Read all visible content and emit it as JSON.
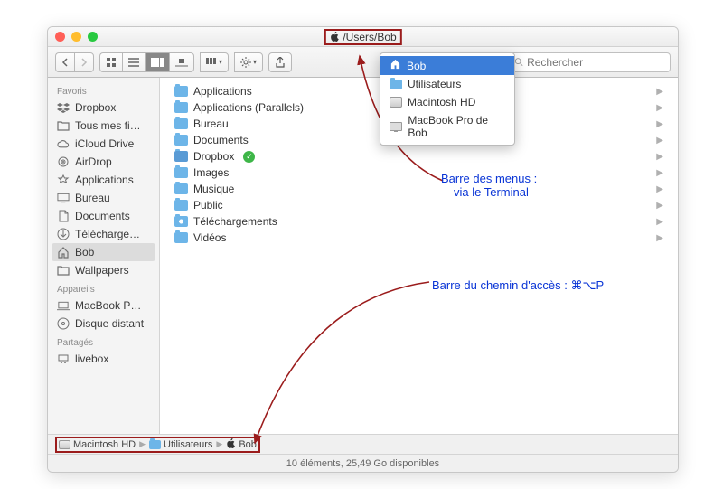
{
  "title_path": "/Users/Bob",
  "search_placeholder": "Rechercher",
  "sidebar": {
    "sections": [
      {
        "header": "Favoris",
        "items": [
          {
            "icon": "dropbox",
            "label": "Dropbox"
          },
          {
            "icon": "folder",
            "label": "Tous mes fi…"
          },
          {
            "icon": "cloud",
            "label": "iCloud Drive"
          },
          {
            "icon": "airdrop",
            "label": "AirDrop"
          },
          {
            "icon": "apps",
            "label": "Applications"
          },
          {
            "icon": "desktop",
            "label": "Bureau"
          },
          {
            "icon": "docs",
            "label": "Documents"
          },
          {
            "icon": "download",
            "label": "Télécharge…"
          },
          {
            "icon": "home",
            "label": "Bob",
            "selected": true
          },
          {
            "icon": "folder",
            "label": "Wallpapers"
          }
        ]
      },
      {
        "header": "Appareils",
        "items": [
          {
            "icon": "laptop",
            "label": "MacBook P…"
          },
          {
            "icon": "disc",
            "label": "Disque distant"
          }
        ]
      },
      {
        "header": "Partagés",
        "items": [
          {
            "icon": "net",
            "label": "livebox"
          }
        ]
      }
    ]
  },
  "files": [
    {
      "label": "Applications",
      "icon": "folder"
    },
    {
      "label": "Applications (Parallels)",
      "icon": "folder"
    },
    {
      "label": "Bureau",
      "icon": "folder"
    },
    {
      "label": "Documents",
      "icon": "folder"
    },
    {
      "label": "Dropbox",
      "icon": "folder-drop",
      "synced": true
    },
    {
      "label": "Images",
      "icon": "folder"
    },
    {
      "label": "Musique",
      "icon": "folder"
    },
    {
      "label": "Public",
      "icon": "folder"
    },
    {
      "label": "Téléchargements",
      "icon": "folder-dl"
    },
    {
      "label": "Vidéos",
      "icon": "folder"
    }
  ],
  "dropdown": [
    {
      "icon": "home",
      "label": "Bob",
      "selected": true
    },
    {
      "icon": "folder",
      "label": "Utilisateurs"
    },
    {
      "icon": "hd",
      "label": "Macintosh HD"
    },
    {
      "icon": "laptop",
      "label": "MacBook Pro de Bob"
    }
  ],
  "pathbar": [
    {
      "icon": "hd",
      "label": "Macintosh HD"
    },
    {
      "icon": "folder",
      "label": "Utilisateurs"
    },
    {
      "icon": "home",
      "label": "Bob"
    }
  ],
  "status": "10 éléments, 25,49 Go disponibles",
  "annotations": {
    "a1_line1": "Barre des menus :",
    "a1_line2": "via le Terminal",
    "a2": "Barre du chemin d'accès : ⌘⌥P"
  }
}
